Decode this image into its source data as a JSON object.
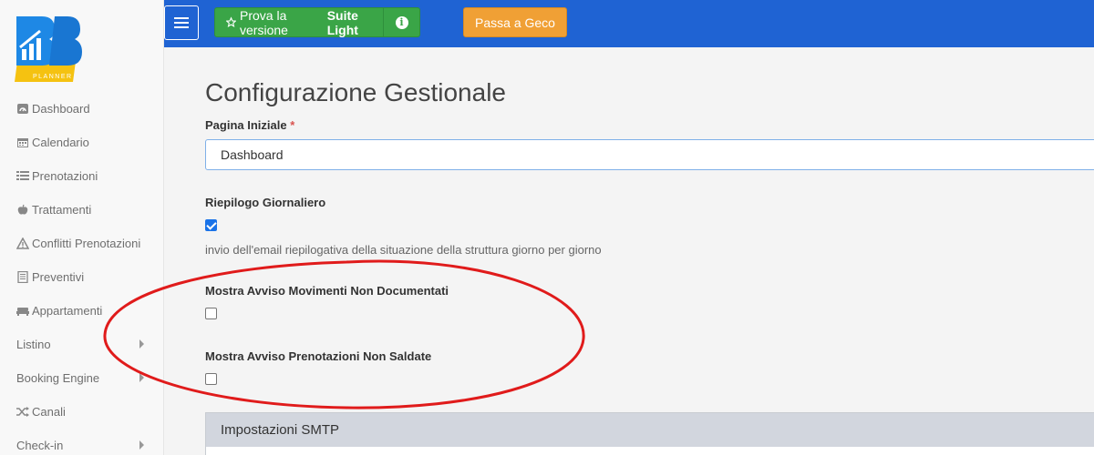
{
  "logo": {
    "brand": "BB",
    "sub": "PLANNER"
  },
  "sidebar": {
    "items": [
      {
        "label": "Dashboard",
        "icon": "dashboard-icon",
        "submenu": false
      },
      {
        "label": "Calendario",
        "icon": "calendar-icon",
        "submenu": false
      },
      {
        "label": "Prenotazioni",
        "icon": "list-icon",
        "submenu": false
      },
      {
        "label": "Trattamenti",
        "icon": "apple-icon",
        "submenu": false
      },
      {
        "label": "Conflitti Prenotazioni",
        "icon": "warning-icon",
        "submenu": false
      },
      {
        "label": "Preventivi",
        "icon": "document-icon",
        "submenu": false
      },
      {
        "label": "Appartamenti",
        "icon": "bed-icon",
        "submenu": false
      },
      {
        "label": "Listino",
        "icon": "",
        "submenu": true
      },
      {
        "label": "Booking Engine",
        "icon": "",
        "submenu": true
      },
      {
        "label": "Canali",
        "icon": "shuffle-icon",
        "submenu": false
      },
      {
        "label": "Check-in",
        "icon": "",
        "submenu": true
      }
    ]
  },
  "topbar": {
    "suite_prefix": "Prova la versione",
    "suite_bold": "Suite Light",
    "info_glyph": "i",
    "geco_label": "Passa a Geco",
    "color": "#1f63d3"
  },
  "main": {
    "title": "Configurazione Gestionale",
    "pagina_iniziale_label": "Pagina Iniziale",
    "required_mark": "*",
    "pagina_iniziale_value": "Dashboard",
    "riepilogo_label": "Riepilogo Giornaliero",
    "riepilogo_checked": true,
    "riepilogo_help": "invio dell'email riepilogativa della situazione della struttura giorno per giorno",
    "movimenti_label": "Mostra Avviso Movimenti Non Documentati",
    "movimenti_checked": false,
    "prenotazioni_label": "Mostra Avviso Prenotazioni Non Saldate",
    "prenotazioni_checked": false,
    "smtp_panel_title": "Impostazioni SMTP"
  },
  "annotation": {
    "shape": "ellipse",
    "color": "#e01b1b"
  }
}
